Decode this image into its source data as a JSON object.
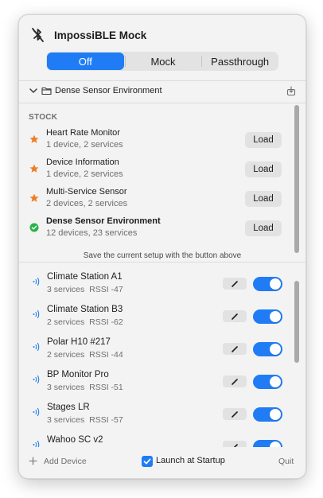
{
  "app": {
    "title": "ImpossiBLE Mock",
    "icon": "bluetooth-disabled-icon"
  },
  "mode_selector": {
    "options": [
      "Off",
      "Mock",
      "Passthrough"
    ],
    "selected": "Off"
  },
  "environment": {
    "name": "Dense Sensor Environment",
    "expanded": true,
    "icons": [
      "chevron-down-icon",
      "folder-icon",
      "export-icon"
    ]
  },
  "stock": {
    "section_label": "STOCK",
    "items": [
      {
        "title": "Heart Rate Monitor",
        "subtitle": "1 device, 2 services",
        "icon": "star-icon",
        "load_label": "Load",
        "active": false
      },
      {
        "title": "Device Information",
        "subtitle": "1 device, 2 services",
        "icon": "star-icon",
        "load_label": "Load",
        "active": false
      },
      {
        "title": "Multi-Service Sensor",
        "subtitle": "2 devices, 2 services",
        "icon": "star-icon",
        "load_label": "Load",
        "active": false
      },
      {
        "title": "Dense Sensor Environment",
        "subtitle": "12 devices, 23 services",
        "icon": "checkmark-circle-icon",
        "load_label": "Load",
        "active": true
      }
    ],
    "hint": "Save the current setup with the button above"
  },
  "devices": [
    {
      "name": "Climate Station A1",
      "services": "3 services",
      "rssi": "RSSI -47",
      "enabled": true
    },
    {
      "name": "Climate Station B3",
      "services": "2 services",
      "rssi": "RSSI -62",
      "enabled": true
    },
    {
      "name": "Polar H10 #217",
      "services": "2 services",
      "rssi": "RSSI -44",
      "enabled": true
    },
    {
      "name": "BP Monitor Pro",
      "services": "3 services",
      "rssi": "RSSI -51",
      "enabled": true
    },
    {
      "name": "Stages LR",
      "services": "3 services",
      "rssi": "RSSI -57",
      "enabled": true
    },
    {
      "name": "Wahoo SC v2",
      "services": "",
      "rssi": "",
      "enabled": true
    }
  ],
  "footer": {
    "add_device_label": "Add Device",
    "launch_at_startup_label": "Launch at Startup",
    "launch_at_startup_checked": true,
    "quit_label": "Quit"
  },
  "colors": {
    "accent": "#1f7cf5",
    "star": "#ee7d23",
    "active_check": "#27b24a"
  }
}
